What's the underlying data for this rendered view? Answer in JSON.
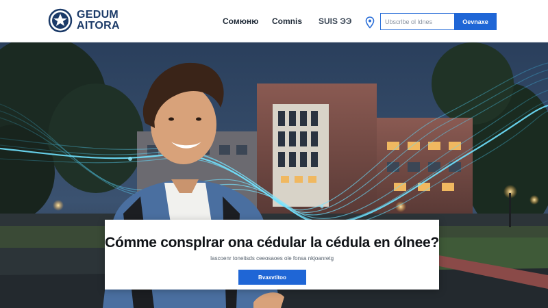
{
  "header": {
    "logo": {
      "line1": "GEDUM",
      "line2": "AITORA",
      "icon": "crest-icon"
    },
    "nav": [
      {
        "label": "Cомюню"
      },
      {
        "label": "Comnis"
      },
      {
        "label": "SUIS ЭЭ"
      }
    ],
    "location_icon": "map-pin-icon",
    "search": {
      "placeholder": "Ubscrlbe ol ldnes",
      "button_label": "Oevnaxe"
    }
  },
  "hero": {
    "title": "Cómme consplrar ona cédular la cédula en ólnee?",
    "subtitle": "Iascoenr toneitsds ceeosaoes ole fonsa nkjoanretg",
    "cta_label": "Bvaxvtitoo"
  },
  "colors": {
    "brand": "#1b3a68",
    "accent": "#1f66d6",
    "glow": "#3fd0ff"
  }
}
